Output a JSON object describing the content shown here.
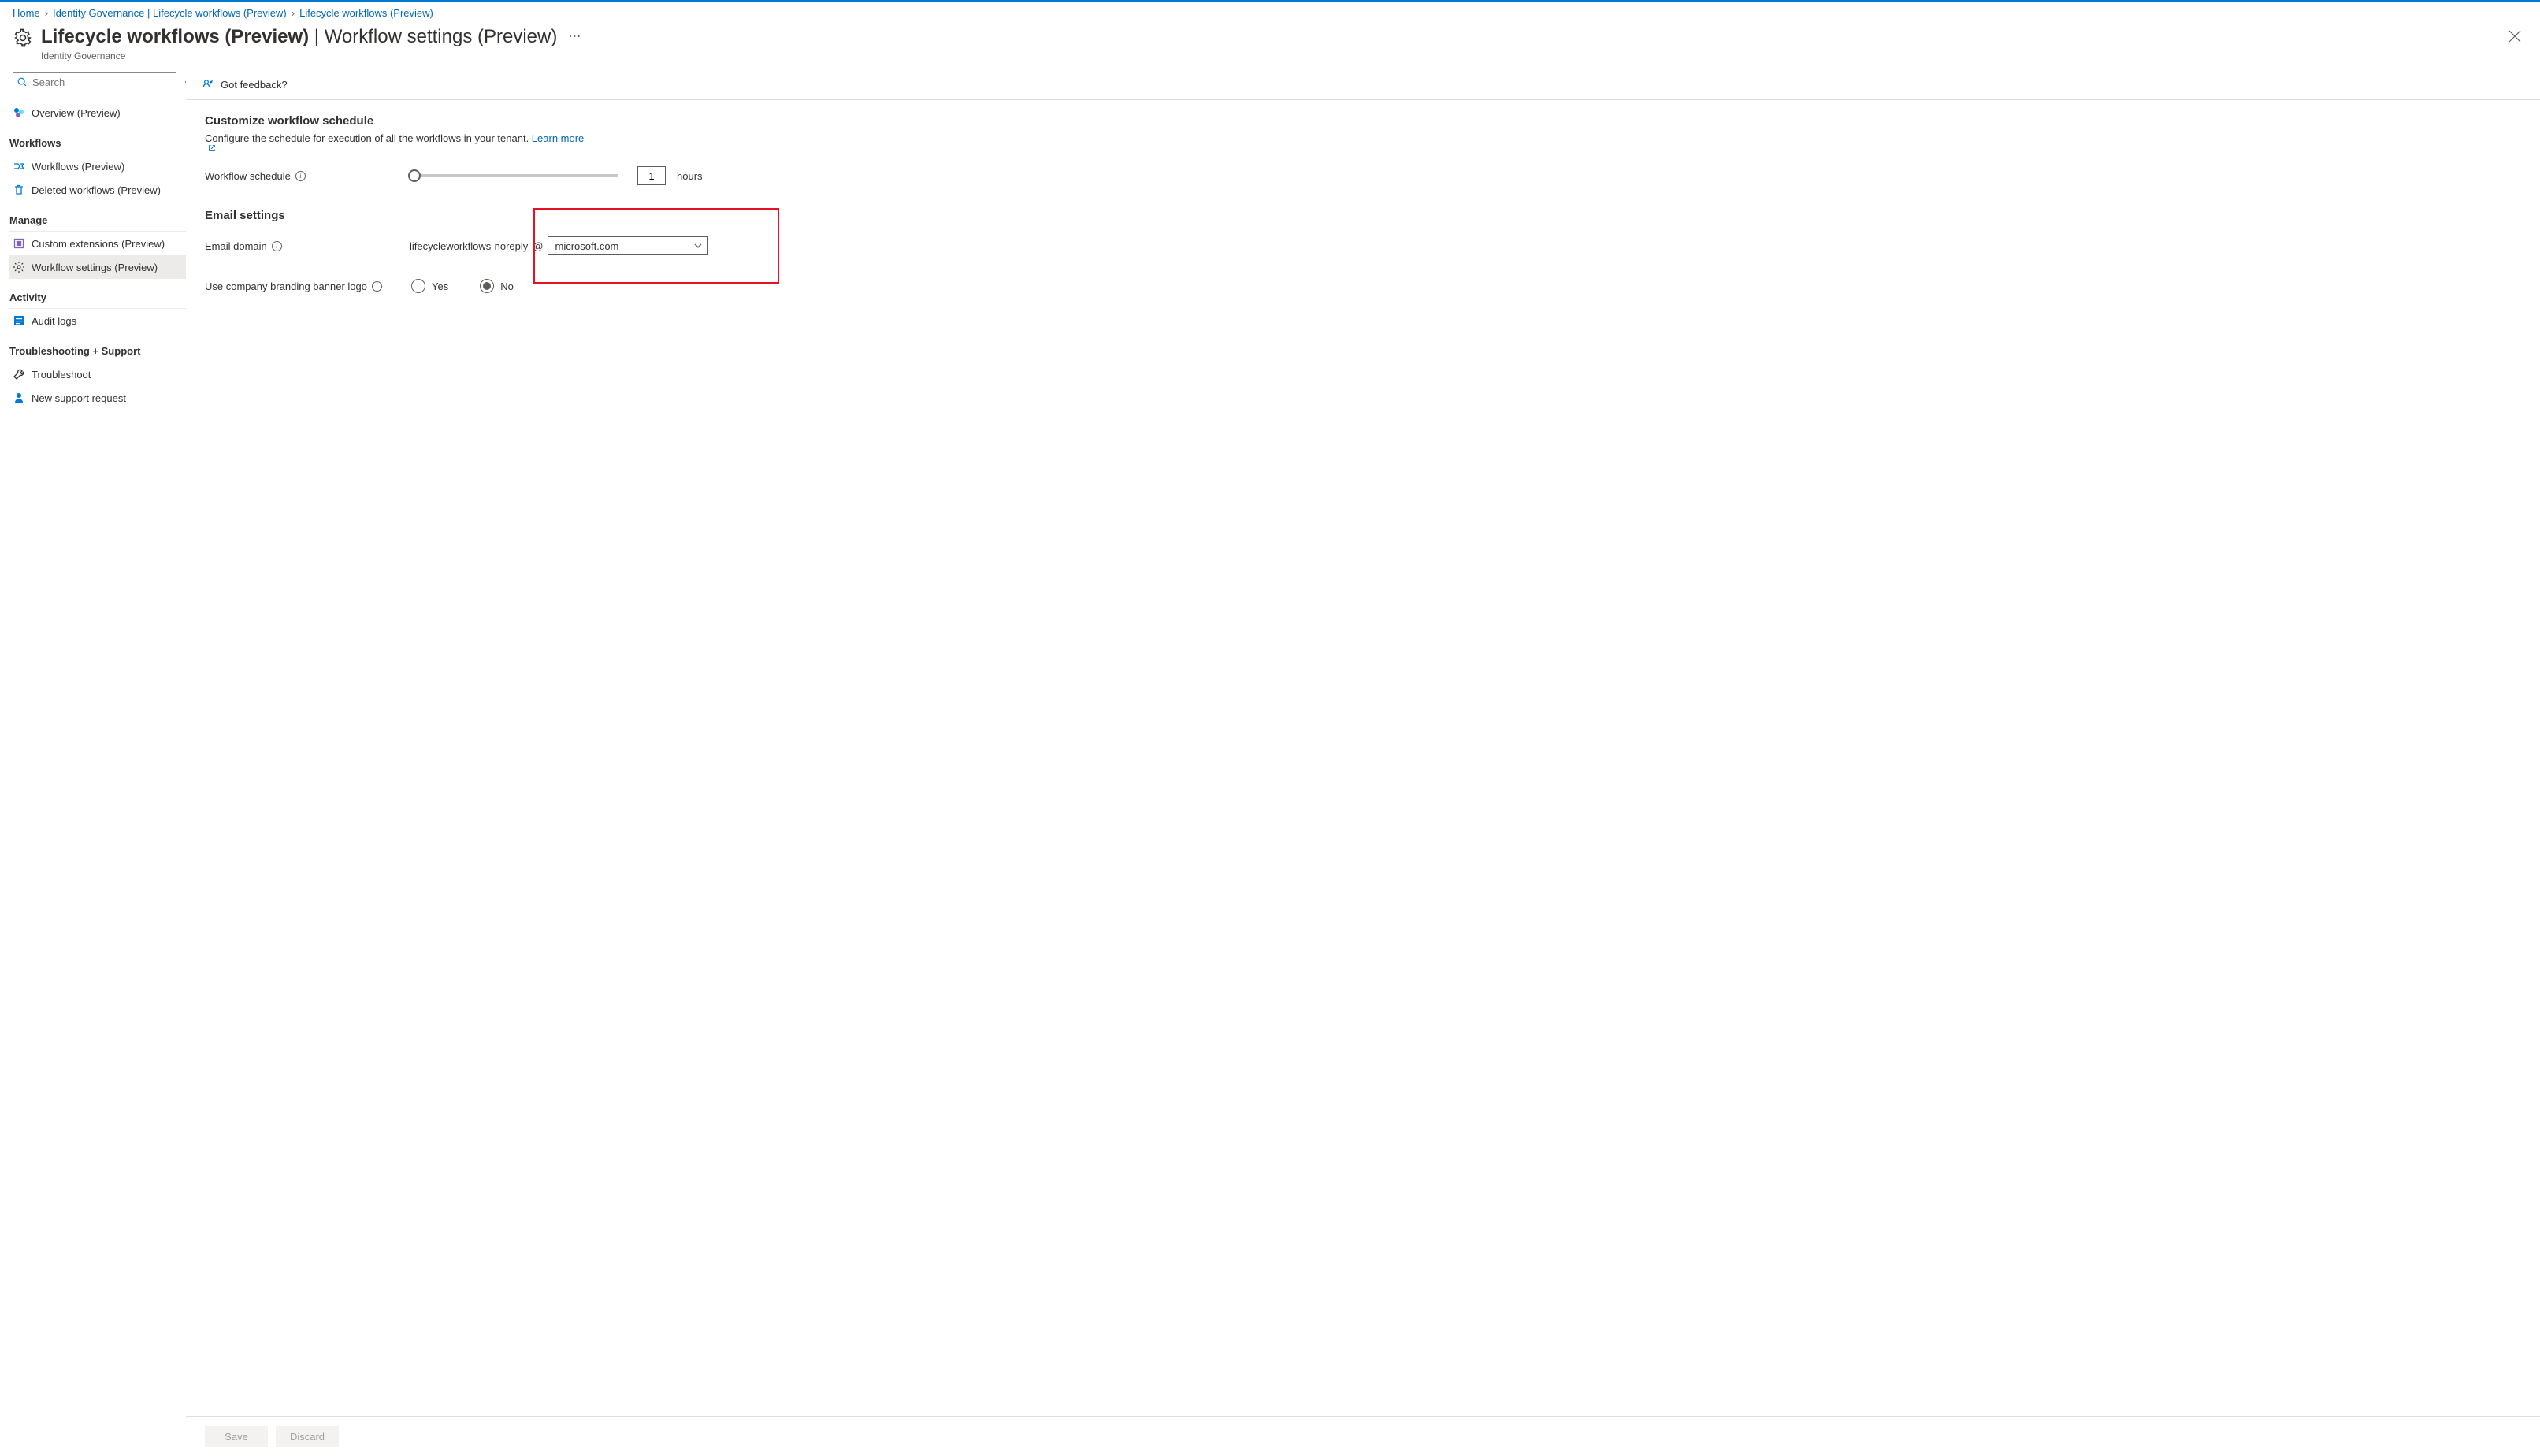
{
  "breadcrumb": {
    "items": [
      "Home",
      "Identity Governance | Lifecycle workflows (Preview)",
      "Lifecycle workflows (Preview)"
    ]
  },
  "header": {
    "title_bold": "Lifecycle workflows (Preview)",
    "title_sep": " | ",
    "title_thin": "Workflow settings (Preview)",
    "subtitle": "Identity Governance"
  },
  "sidebar": {
    "search_placeholder": "Search",
    "overview": "Overview (Preview)",
    "heading_workflows": "Workflows",
    "item_workflows": "Workflows (Preview)",
    "item_deleted": "Deleted workflows (Preview)",
    "heading_manage": "Manage",
    "item_custom_ext": "Custom extensions (Preview)",
    "item_workflow_settings": "Workflow settings (Preview)",
    "heading_activity": "Activity",
    "item_audit": "Audit logs",
    "heading_trouble": "Troubleshooting + Support",
    "item_troubleshoot": "Troubleshoot",
    "item_support": "New support request"
  },
  "toolbar": {
    "feedback": "Got feedback?"
  },
  "content": {
    "schedule_title": "Customize workflow schedule",
    "schedule_desc": "Configure the schedule for execution of all the workflows in your tenant. ",
    "learn_more": "Learn more",
    "schedule_label": "Workflow schedule",
    "schedule_value": "1",
    "schedule_unit": "hours",
    "email_title": "Email settings",
    "email_domain_label": "Email domain",
    "email_prefix": "lifecycleworkflows-noreply",
    "email_at": "@",
    "email_domain_value": "microsoft.com",
    "branding_label": "Use company branding banner logo",
    "yes": "Yes",
    "no": "No"
  },
  "footer": {
    "save": "Save",
    "discard": "Discard"
  }
}
